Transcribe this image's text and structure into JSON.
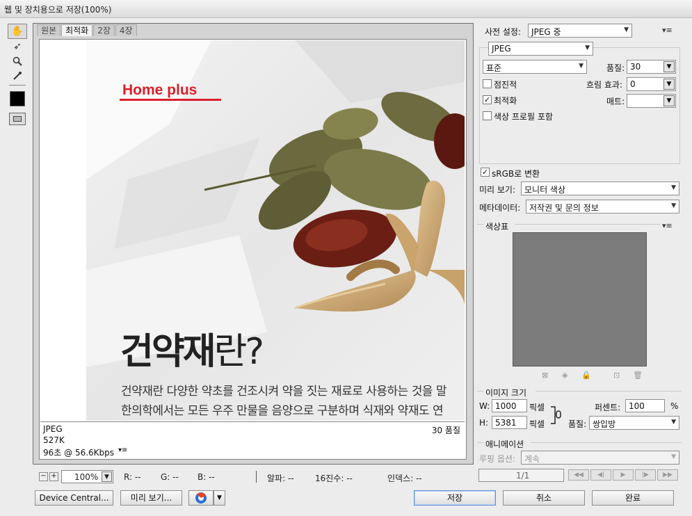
{
  "window": {
    "title": "웹 및 장치용으로 저장(100%)"
  },
  "tools": [
    {
      "name": "hand-tool",
      "glyph": "✋"
    },
    {
      "name": "slice-select-tool",
      "glyph": "➶"
    },
    {
      "name": "zoom-tool",
      "glyph": "🔍"
    },
    {
      "name": "eyedropper-tool",
      "glyph": "✎"
    }
  ],
  "tabs": [
    "원본",
    "최적화",
    "2장",
    "4장"
  ],
  "active_tab": "최적화",
  "preview": {
    "logo": "Home plus",
    "heading_bold": "건약재",
    "heading_light": "란?",
    "body_line1": "건약재란 다양한 약초를 건조시켜 약을 짓는 재료로 사용하는 것을 말",
    "body_line2": "한의학에서는 모든 우주 만물을 음양으로 구분하며 식재와 약재도 연"
  },
  "info": {
    "format": "JPEG",
    "size": "527K",
    "time": "96초 @ 56.6Kbps",
    "menu": "▾≡",
    "quality": "30 품질"
  },
  "status": {
    "zoom": "100%",
    "r": "R: --",
    "g": "G: --",
    "b": "B: --",
    "alpha": "알파: --",
    "hex": "16진수: --",
    "index": "인덱스: --"
  },
  "settings": {
    "preset_label": "사전 설정:",
    "preset_value": "JPEG 중",
    "format": "JPEG",
    "compression": "표준",
    "quality_label": "품질:",
    "quality_value": "30",
    "progressive": "점진적",
    "blur_label": "흐림 효과:",
    "blur_value": "0",
    "optimized": "최적화",
    "matte_label": "매트:",
    "color_profile": "색상 프로필 포함",
    "srgb": "sRGB로 변환",
    "preview_label": "미리 보기:",
    "preview_value": "모니터 색상",
    "metadata_label": "메타데이터:",
    "metadata_value": "저작권 및 문의 정보"
  },
  "color_table": {
    "title": "색상표"
  },
  "image_size": {
    "title": "이미지 크기",
    "w_label": "W:",
    "w_value": "1000",
    "h_label": "H:",
    "h_value": "5381",
    "unit": "픽셀",
    "percent_label": "퍼센트:",
    "percent_value": "100",
    "percent_unit": "%",
    "quality_label": "품질:",
    "quality_value": "쌍입방"
  },
  "animation": {
    "title": "애니메이션",
    "loop_label": "루핑 옵션:",
    "loop_value": "계속",
    "frame": "1/1"
  },
  "buttons": {
    "device_central": "Device Central...",
    "preview": "미리 보기...",
    "save": "저장",
    "cancel": "취소",
    "done": "완료"
  }
}
